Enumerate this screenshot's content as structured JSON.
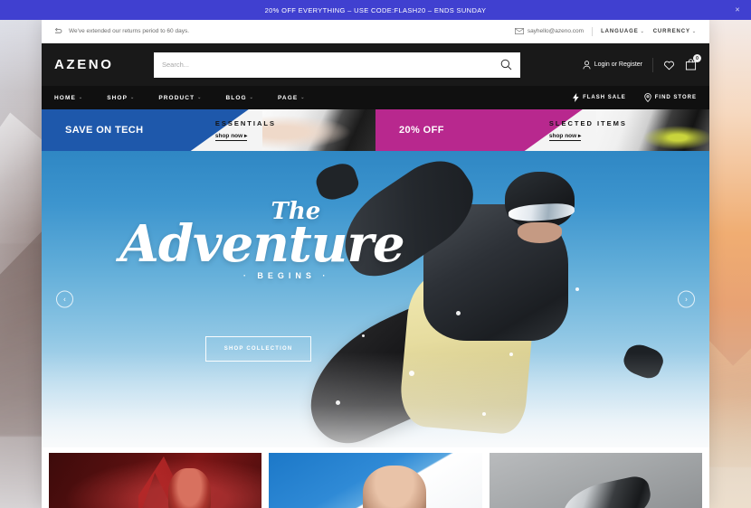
{
  "announcement": {
    "text": "20% OFF EVERYTHING – USE CODE:FLASH20 – ENDS SUNDAY",
    "close_label": "×",
    "bg_color": "#4040d0"
  },
  "utility": {
    "returns_notice": "We've extended our returns period to 60 days.",
    "returns_icon": "return-arrow-icon",
    "email": "sayhello@azeno.com",
    "email_icon": "envelope-icon",
    "language_label": "LANGUAGE",
    "currency_label": "CURRENCY",
    "caret": "⌄"
  },
  "header": {
    "logo": "AZENO",
    "search": {
      "placeholder": "Search...",
      "value": "",
      "icon": "search-icon"
    },
    "account_label": "Login or Register",
    "account_icon": "user-icon",
    "wishlist_icon": "heart-icon",
    "cart_icon": "shopping-bag-icon",
    "cart_count": "0",
    "bg_color": "#191919"
  },
  "nav": {
    "items": [
      {
        "label": "HOME",
        "caret": "⌄"
      },
      {
        "label": "SHOP",
        "caret": "⌄"
      },
      {
        "label": "PRODUCT",
        "caret": "⌄"
      },
      {
        "label": "BLOG",
        "caret": "⌄"
      },
      {
        "label": "PAGE",
        "caret": "⌄"
      }
    ],
    "actions": [
      {
        "label": "FLASH SALE",
        "icon": "lightning-bolt-icon"
      },
      {
        "label": "FIND STORE",
        "icon": "map-pin-icon"
      }
    ],
    "bg_color": "#101010"
  },
  "promos": [
    {
      "headline": "SAVE ON TECH",
      "label": "ESSENTIALS",
      "link": "shop now ▸",
      "color": "#1e58ab"
    },
    {
      "headline": "20% OFF",
      "label": "SLECTED ITEMS",
      "link": "shop now ▸",
      "color": "#b8288e"
    }
  ],
  "hero": {
    "title_line1": "The",
    "title_line2": "Adventure",
    "title_line3": "· BEGINS ·",
    "cta_label": "SHOP COLLECTION",
    "prev_arrow": "‹",
    "next_arrow": "›"
  },
  "cards": [
    {
      "name": "card-red-portrait"
    },
    {
      "name": "card-blue-sky-portrait"
    },
    {
      "name": "card-grey-sneaker"
    }
  ]
}
